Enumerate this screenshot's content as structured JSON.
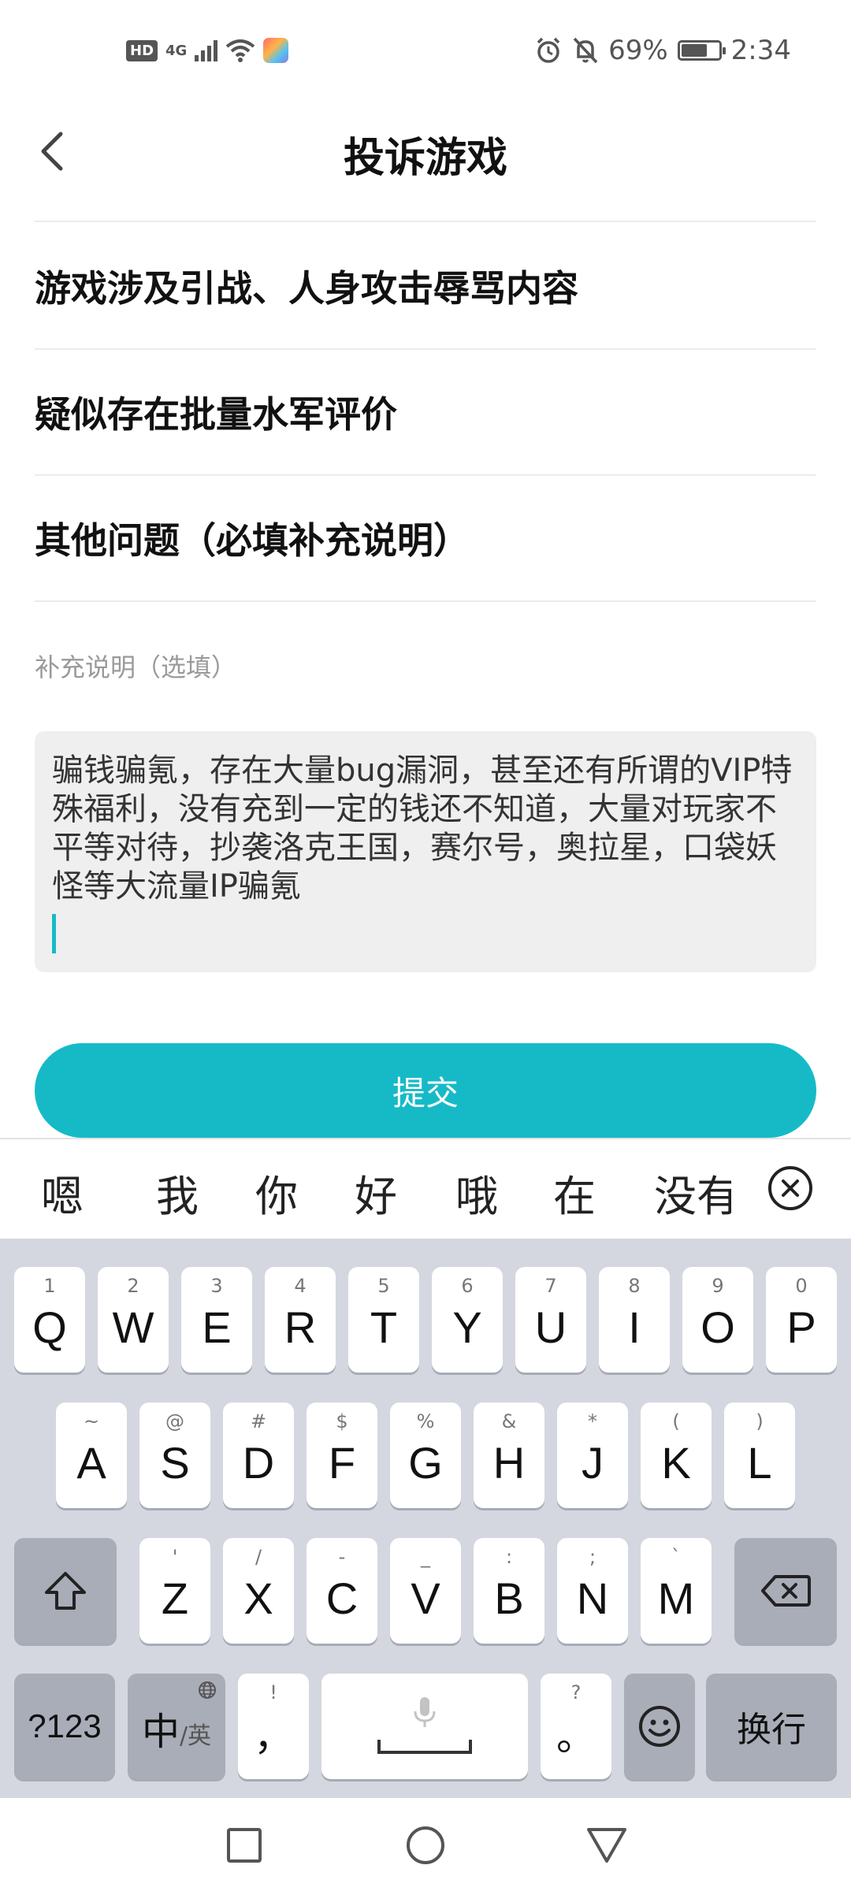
{
  "status_bar": {
    "hd_badge": "HD",
    "network": "4G",
    "battery_percent": "69%",
    "time": "2:34",
    "battery_level": 0.69
  },
  "header": {
    "title": "投诉游戏"
  },
  "reasons": [
    {
      "label": "游戏涉及引战、人身攻击辱骂内容"
    },
    {
      "label": "疑似存在批量水军评价"
    },
    {
      "label": "其他问题（必填补充说明）"
    }
  ],
  "note": {
    "label": "补充说明（选填）",
    "value": "骗钱骗氪，存在大量bug漏洞，甚至还有所谓的VIP特殊福利，没有充到一定的钱还不知道，大量对玩家不平等对待，抄袭洛克王国，赛尔号，奥拉星，口袋妖怪等大流量IP骗氪"
  },
  "submit_label": "提交",
  "candidates": [
    "嗯",
    "我",
    "你",
    "好",
    "哦",
    "在",
    "没有"
  ],
  "keyboard": {
    "row1": [
      {
        "main": "Q",
        "hint": "1"
      },
      {
        "main": "W",
        "hint": "2"
      },
      {
        "main": "E",
        "hint": "3"
      },
      {
        "main": "R",
        "hint": "4"
      },
      {
        "main": "T",
        "hint": "5"
      },
      {
        "main": "Y",
        "hint": "6"
      },
      {
        "main": "U",
        "hint": "7"
      },
      {
        "main": "I",
        "hint": "8"
      },
      {
        "main": "O",
        "hint": "9"
      },
      {
        "main": "P",
        "hint": "0"
      }
    ],
    "row2": [
      {
        "main": "A",
        "hint": "~"
      },
      {
        "main": "S",
        "hint": "@"
      },
      {
        "main": "D",
        "hint": "#"
      },
      {
        "main": "F",
        "hint": "$"
      },
      {
        "main": "G",
        "hint": "%"
      },
      {
        "main": "H",
        "hint": "&"
      },
      {
        "main": "J",
        "hint": "*"
      },
      {
        "main": "K",
        "hint": "("
      },
      {
        "main": "L",
        "hint": ")"
      }
    ],
    "row3": [
      {
        "main": "Z",
        "hint": "'"
      },
      {
        "main": "X",
        "hint": "/"
      },
      {
        "main": "C",
        "hint": "-"
      },
      {
        "main": "V",
        "hint": "_"
      },
      {
        "main": "B",
        "hint": ":"
      },
      {
        "main": "N",
        "hint": ";"
      },
      {
        "main": "M",
        "hint": "`"
      }
    ],
    "num_label": "?123",
    "lang_main": "中",
    "lang_sub": "/英",
    "comma_main": "，",
    "comma_hint": "!",
    "period_main": "。",
    "period_hint": "?",
    "enter_label": "换行"
  },
  "icons": {
    "back": "chevron-left-icon",
    "alarm": "alarm-icon",
    "mute": "bell-off-icon",
    "shift": "shift-icon",
    "backspace": "backspace-icon",
    "globe": "globe-icon",
    "mic": "microphone-icon",
    "emoji": "emoji-icon",
    "close": "close-circle-icon"
  },
  "colors": {
    "accent": "#16bac7",
    "keyboard_bg": "#d4d7df",
    "function_key": "#a9adb8"
  }
}
